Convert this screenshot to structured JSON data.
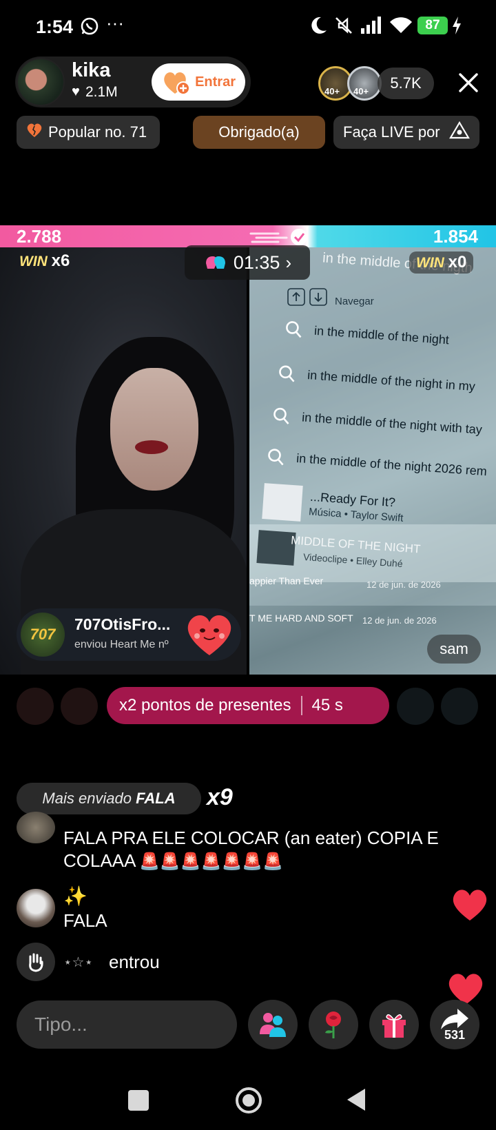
{
  "status_bar": {
    "time": "1:54",
    "battery": "87"
  },
  "host": {
    "name": "kika",
    "likes": "2.1M",
    "follow_label": "Entrar"
  },
  "viewers": {
    "badge_1": "40+",
    "badge_2": "40+",
    "count": "5.7K"
  },
  "pills": {
    "popular": "Popular no. 71",
    "thanks": "Obrigado(a)",
    "live": "Faça LIVE por"
  },
  "battle": {
    "left_score": "2.788",
    "right_score": "1.854",
    "timer": "01:35",
    "left_win_label": "WIN",
    "left_win_count": "x6",
    "right_win_label": "WIN",
    "right_win_count": "x0"
  },
  "right_screen": {
    "header_query": "in the middle of the nigth",
    "nav_label": "Navegar",
    "suggestions": [
      "in the middle of the night",
      "in the middle of the night in my",
      "in the middle of the night with tay",
      "in the middle of the night 2026 rem"
    ],
    "result_1_title": "...Ready For It?",
    "result_1_sub": "Música • Taylor Swift",
    "result_2_title": "MIDDLE OF THE NIGHT",
    "result_2_sub": "Videoclipe • Elley Duhé",
    "row_a": "appier Than Ever",
    "row_a_date": "12 de jun. de 2026",
    "row_b": "T ME HARD AND SOFT",
    "row_b_date": "12 de jun. de 2026",
    "name_tag": "sam"
  },
  "gift_banner": {
    "user": "707OtisFro...",
    "message": "enviou Heart Me nº",
    "avatar_text": "707"
  },
  "boost": {
    "label": "x2 pontos de presentes",
    "seconds": "45 s"
  },
  "most_sent": {
    "label": "Mais enviado",
    "word": "FALA",
    "multiplier": "x9"
  },
  "chat": [
    {
      "text": "FALA PRA ELE COLOCAR  (an eater) COPIA E COLAAA"
    },
    {
      "sparkle": "✨",
      "text": "FALA"
    },
    {
      "stars": "⋆☆⋆",
      "text": "entrou"
    }
  ],
  "bottom": {
    "placeholder": "Tipo...",
    "share_count": "531"
  },
  "colors": {
    "accent_pink": "#f25aa0",
    "accent_cyan": "#21c4e6",
    "boost": "#a3174c",
    "follow": "#f2743a"
  }
}
